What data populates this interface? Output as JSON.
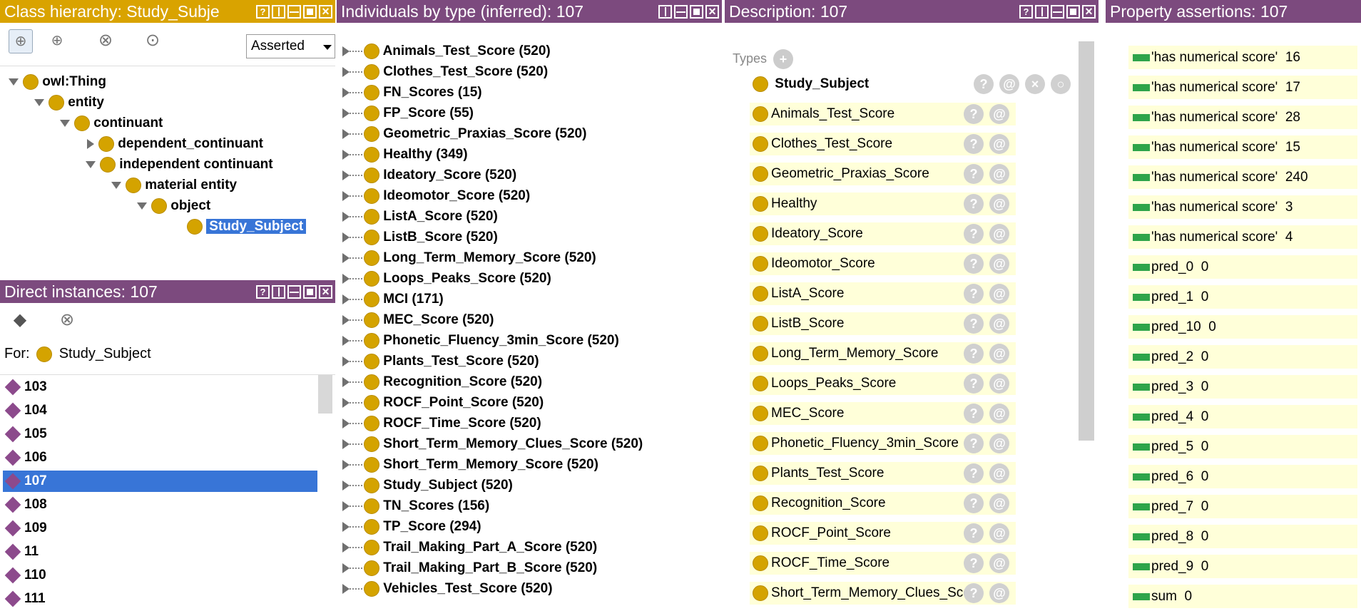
{
  "class_hierarchy": {
    "title": "Class hierarchy: Study_Subje",
    "mode": "Asserted",
    "tree": [
      {
        "label": "owl:Thing",
        "depth": 0,
        "state": "open"
      },
      {
        "label": "entity",
        "depth": 1,
        "state": "open"
      },
      {
        "label": "continuant",
        "depth": 2,
        "state": "open"
      },
      {
        "label": "dependent_continuant",
        "depth": 3,
        "state": "closed"
      },
      {
        "label": "independent continuant",
        "depth": 3,
        "state": "open"
      },
      {
        "label": "material entity",
        "depth": 4,
        "state": "open"
      },
      {
        "label": "object",
        "depth": 5,
        "state": "open"
      },
      {
        "label": "Study_Subject",
        "depth": 6,
        "state": "leaf",
        "selected": true
      }
    ]
  },
  "direct_instances": {
    "title": "Direct instances: 107",
    "for_label": "For:",
    "for_class": "Study_Subject",
    "items": [
      "103",
      "104",
      "105",
      "106",
      "107",
      "108",
      "109",
      "11",
      "110",
      "111"
    ],
    "selected": "107"
  },
  "individuals": {
    "title": "Individuals by type (inferred): 107",
    "items": [
      "Animals_Test_Score (520)",
      "Clothes_Test_Score (520)",
      "FN_Scores (15)",
      "FP_Score (55)",
      "Geometric_Praxias_Score (520)",
      "Healthy (349)",
      "Ideatory_Score (520)",
      "Ideomotor_Score (520)",
      "ListA_Score (520)",
      "ListB_Score (520)",
      "Long_Term_Memory_Score (520)",
      "Loops_Peaks_Score (520)",
      "MCI (171)",
      "MEC_Score (520)",
      "Phonetic_Fluency_3min_Score (520)",
      "Plants_Test_Score (520)",
      "Recognition_Score (520)",
      "ROCF_Point_Score (520)",
      "ROCF_Time_Score (520)",
      "Short_Term_Memory_Clues_Score (520)",
      "Short_Term_Memory_Score (520)",
      "Study_Subject (520)",
      "TN_Scores (156)",
      "TP_Score (294)",
      "Trail_Making_Part_A_Score (520)",
      "Trail_Making_Part_B_Score (520)",
      "Vehicles_Test_Score (520)"
    ]
  },
  "description": {
    "title": "Description: 107",
    "types_label": "Types",
    "primary_type": "Study_Subject",
    "types": [
      "Animals_Test_Score",
      "Clothes_Test_Score",
      "Geometric_Praxias_Score",
      "Healthy",
      "Ideatory_Score",
      "Ideomotor_Score",
      "ListA_Score",
      "ListB_Score",
      "Long_Term_Memory_Score",
      "Loops_Peaks_Score",
      "MEC_Score",
      "Phonetic_Fluency_3min_Score",
      "Plants_Test_Score",
      "Recognition_Score",
      "ROCF_Point_Score",
      "ROCF_Time_Score",
      "Short_Term_Memory_Clues_Sco"
    ]
  },
  "property_assertions": {
    "title": "Property assertions: 107",
    "items": [
      {
        "prop": "'has numerical score'",
        "value": "16"
      },
      {
        "prop": "'has numerical score'",
        "value": "17"
      },
      {
        "prop": "'has numerical score'",
        "value": "28"
      },
      {
        "prop": "'has numerical score'",
        "value": "15"
      },
      {
        "prop": "'has numerical score'",
        "value": "240"
      },
      {
        "prop": "'has numerical score'",
        "value": "3"
      },
      {
        "prop": "'has numerical score'",
        "value": "4"
      },
      {
        "prop": "pred_0",
        "value": "0"
      },
      {
        "prop": "pred_1",
        "value": "0"
      },
      {
        "prop": "pred_10",
        "value": "0"
      },
      {
        "prop": "pred_2",
        "value": "0"
      },
      {
        "prop": "pred_3",
        "value": "0"
      },
      {
        "prop": "pred_4",
        "value": "0"
      },
      {
        "prop": "pred_5",
        "value": "0"
      },
      {
        "prop": "pred_6",
        "value": "0"
      },
      {
        "prop": "pred_7",
        "value": "0"
      },
      {
        "prop": "pred_8",
        "value": "0"
      },
      {
        "prop": "pred_9",
        "value": "0"
      },
      {
        "prop": "sum",
        "value": "0"
      }
    ]
  },
  "colors": {
    "class_header": "#d9a300",
    "view_header": "#7c4a7e",
    "selection": "#3875d7",
    "type_row_bg": "#ffffd9",
    "class_dot": "#d4a300",
    "individual_diamond": "#8c4a8c",
    "data_property_bar": "#2ea44a"
  }
}
